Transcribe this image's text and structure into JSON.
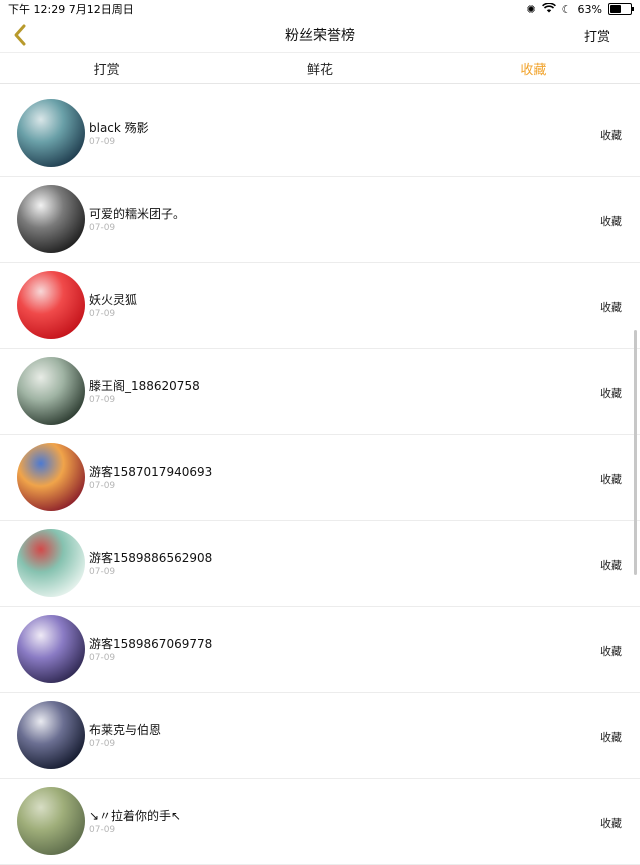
{
  "status_bar": {
    "left": "下午 12:29   7月12日周日",
    "battery": "63%",
    "battery_level": 0.63
  },
  "nav": {
    "title": "粉丝荣誉榜",
    "right_button": "打赏"
  },
  "tabs": [
    {
      "label": "打赏",
      "active": false
    },
    {
      "label": "鲜花",
      "active": false
    },
    {
      "label": "收藏",
      "active": true
    }
  ],
  "colors": {
    "accent": "#f1a32c"
  },
  "fans": [
    {
      "name": "black 殇影",
      "date": "07-09",
      "tag": "收藏",
      "avatar": [
        "#1e3b4d",
        "#6aa0a8",
        "#d9e6e8"
      ]
    },
    {
      "name": "可爱的糯米团子。",
      "date": "07-09",
      "tag": "收藏",
      "avatar": [
        "#1d1d1d",
        "#7a7a7a",
        "#f2f2f2"
      ]
    },
    {
      "name": "妖火灵狐",
      "date": "07-09",
      "tag": "收藏",
      "avatar": [
        "#c3121a",
        "#f04a4a",
        "#f7d7d7"
      ]
    },
    {
      "name": "滕王阁_188620758",
      "date": "07-09",
      "tag": "收藏",
      "avatar": [
        "#2b3a2f",
        "#9fb3a3",
        "#e8ece6"
      ]
    },
    {
      "name": "游客1587017940693",
      "date": "07-09",
      "tag": "收藏",
      "avatar": [
        "#8a1d2a",
        "#f0a44a",
        "#4d7ad1"
      ]
    },
    {
      "name": "游客1589886562908",
      "date": "07-09",
      "tag": "收藏",
      "avatar": [
        "#e9f4ef",
        "#86c2b0",
        "#d24a4a"
      ]
    },
    {
      "name": "游客1589867069778",
      "date": "07-09",
      "tag": "收藏",
      "avatar": [
        "#2e2750",
        "#8a7bc4",
        "#efeaf6"
      ]
    },
    {
      "name": "布莱克与伯恩",
      "date": "07-09",
      "tag": "收藏",
      "avatar": [
        "#141a2e",
        "#6b6f92",
        "#e9eaf0"
      ]
    },
    {
      "name": "↘〃拉着你的手↖",
      "date": "07-09",
      "tag": "收藏",
      "avatar": [
        "#5c6b4a",
        "#9fae7a",
        "#d7ddc4"
      ]
    }
  ]
}
